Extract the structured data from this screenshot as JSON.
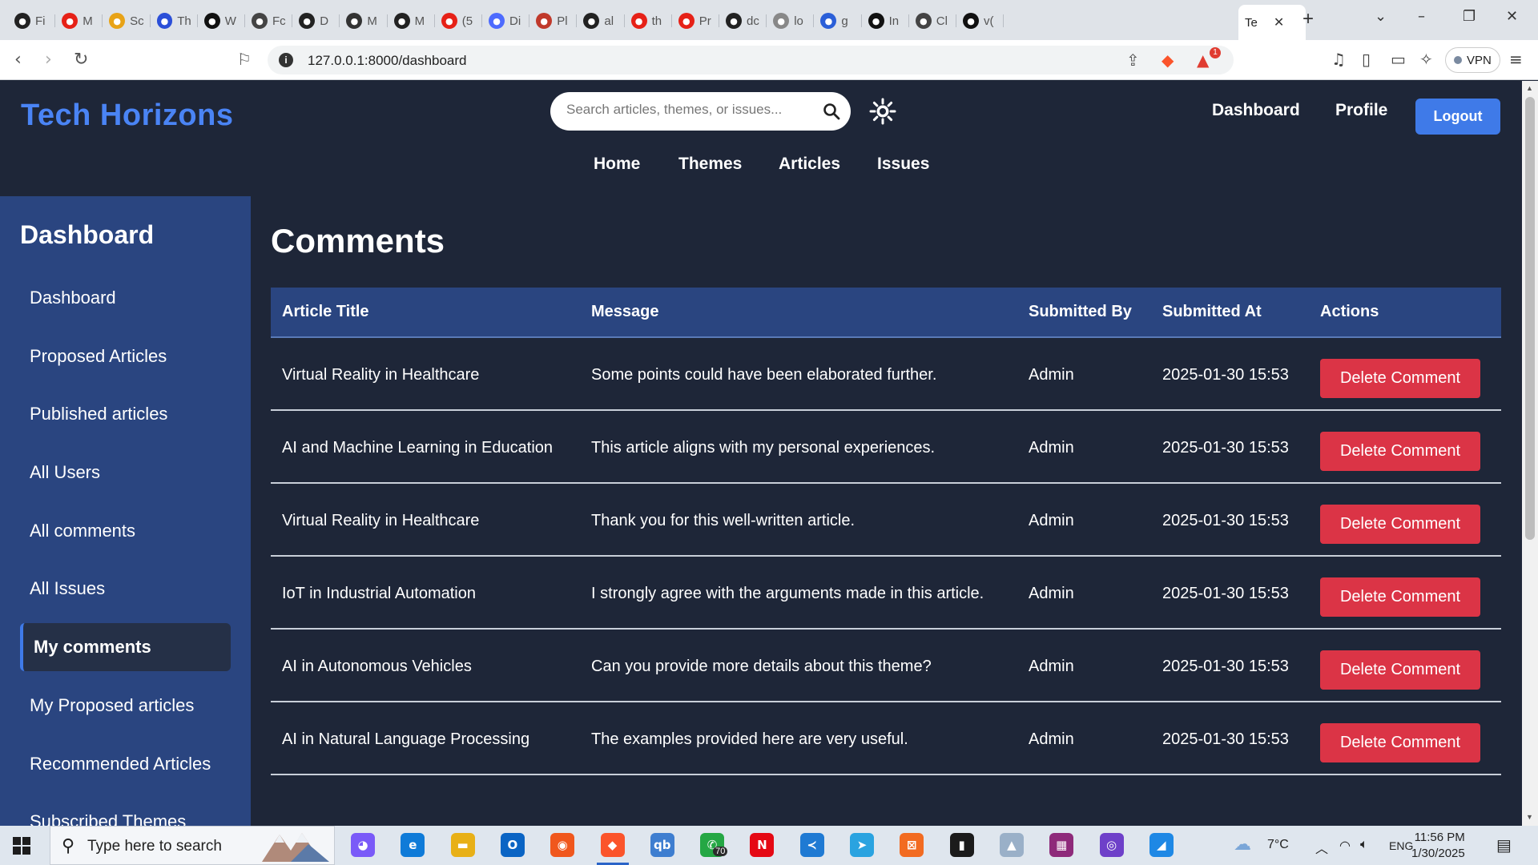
{
  "browser": {
    "tabs": [
      {
        "label": "Fi",
        "icon": "github-icon",
        "color": "#222222"
      },
      {
        "label": "M",
        "icon": "youtube-icon",
        "color": "#e62117"
      },
      {
        "label": "Sc",
        "icon": "scholar-icon",
        "color": "#e8a317"
      },
      {
        "label": "Th",
        "icon": "power-icon",
        "color": "#2b4fd8"
      },
      {
        "label": "W",
        "icon": "medium-icon",
        "color": "#111111"
      },
      {
        "label": "Fc",
        "icon": "openai-icon",
        "color": "#444444"
      },
      {
        "label": "D",
        "icon": "github-icon",
        "color": "#222222"
      },
      {
        "label": "M",
        "icon": "profile-icon",
        "color": "#333333"
      },
      {
        "label": "M",
        "icon": "github-icon",
        "color": "#222222"
      },
      {
        "label": "(5",
        "icon": "youtube-icon",
        "color": "#e62117"
      },
      {
        "label": "Di",
        "icon": "deepseek-icon",
        "color": "#4d6bfe"
      },
      {
        "label": "Pl",
        "icon": "plex-icon",
        "color": "#c0392b"
      },
      {
        "label": "al",
        "icon": "github-icon",
        "color": "#222222"
      },
      {
        "label": "th",
        "icon": "youtube-icon",
        "color": "#e62117"
      },
      {
        "label": "Pr",
        "icon": "youtube-icon",
        "color": "#e62117"
      },
      {
        "label": "dc",
        "icon": "github-icon",
        "color": "#222222"
      },
      {
        "label": "lo",
        "icon": "mountain-icon",
        "color": "#888888"
      },
      {
        "label": "g",
        "icon": "word-icon",
        "color": "#2b5fd8"
      },
      {
        "label": "In",
        "icon": "openai-icon",
        "color": "#111111"
      },
      {
        "label": "Cl",
        "icon": "openai-icon",
        "color": "#444444"
      },
      {
        "label": "v(",
        "icon": "vercel-icon",
        "color": "#111111"
      }
    ],
    "active_tab": {
      "label": "Te",
      "close": "✕"
    },
    "new_tab": "+",
    "url": "127.0.0.1:8000/dashboard",
    "brave_badge": "1",
    "vpn_label": "VPN"
  },
  "site": {
    "brand": "Tech Horizons",
    "search_placeholder": "Search articles, themes, or issues...",
    "top_links": {
      "dashboard": "Dashboard",
      "profile": "Profile",
      "logout": "Logout"
    },
    "main_nav": [
      "Home",
      "Themes",
      "Articles",
      "Issues"
    ]
  },
  "sidebar": {
    "title": "Dashboard",
    "items": [
      {
        "label": "Dashboard",
        "active": false
      },
      {
        "label": "Proposed Articles",
        "active": false
      },
      {
        "label": "Published articles",
        "active": false
      },
      {
        "label": "All Users",
        "active": false
      },
      {
        "label": "All comments",
        "active": false
      },
      {
        "label": "All Issues",
        "active": false
      },
      {
        "label": "My comments",
        "active": true
      },
      {
        "label": "My Proposed articles",
        "active": false
      },
      {
        "label": "Recommended Articles",
        "active": false
      },
      {
        "label": "Subscribed Themes",
        "active": false
      }
    ]
  },
  "comments": {
    "title": "Comments",
    "columns": [
      "Article Title",
      "Message",
      "Submitted By",
      "Submitted At",
      "Actions"
    ],
    "delete_label": "Delete Comment",
    "rows": [
      {
        "article": "Virtual Reality in Healthcare",
        "message": "Some points could have been elaborated further.",
        "by": "Admin",
        "at": "2025-01-30 15:53"
      },
      {
        "article": "AI and Machine Learning in Education",
        "message": "This article aligns with my personal experiences.",
        "by": "Admin",
        "at": "2025-01-30 15:53"
      },
      {
        "article": "Virtual Reality in Healthcare",
        "message": "Thank you for this well-written article.",
        "by": "Admin",
        "at": "2025-01-30 15:53"
      },
      {
        "article": "IoT in Industrial Automation",
        "message": "I strongly agree with the arguments made in this article.",
        "by": "Admin",
        "at": "2025-01-30 15:53"
      },
      {
        "article": "AI in Autonomous Vehicles",
        "message": "Can you provide more details about this theme?",
        "by": "Admin",
        "at": "2025-01-30 15:53"
      },
      {
        "article": "AI in Natural Language Processing",
        "message": "The examples provided here are very useful.",
        "by": "Admin",
        "at": "2025-01-30 15:53"
      }
    ]
  },
  "taskbar": {
    "search_placeholder": "Type here to search",
    "apps": [
      {
        "name": "copilot-icon",
        "glyph": "◕",
        "color": "#7a5af8"
      },
      {
        "name": "edge-icon",
        "glyph": "e",
        "color": "#0f7bd8"
      },
      {
        "name": "file-explorer-icon",
        "glyph": "▬",
        "color": "#e8b017"
      },
      {
        "name": "outlook-icon",
        "glyph": "O",
        "color": "#0a64c4"
      },
      {
        "name": "firefox-icon",
        "glyph": "◉",
        "color": "#f0571d"
      },
      {
        "name": "brave-icon",
        "glyph": "◆",
        "color": "#fb542b"
      },
      {
        "name": "qbittorrent-icon",
        "glyph": "qb",
        "color": "#3e7ed0"
      },
      {
        "name": "whatsapp-icon",
        "glyph": "✆",
        "color": "#25a744"
      },
      {
        "name": "netflix-icon",
        "glyph": "N",
        "color": "#e50914"
      },
      {
        "name": "vscode-icon",
        "glyph": "≺",
        "color": "#1f7ad3"
      },
      {
        "name": "telegram-icon",
        "glyph": "➤",
        "color": "#2aa3e0"
      },
      {
        "name": "xampp-icon",
        "glyph": "⊠",
        "color": "#f26b21"
      },
      {
        "name": "terminal-icon",
        "glyph": "▮",
        "color": "#1b1b1b"
      },
      {
        "name": "photos-icon",
        "glyph": "▲",
        "color": "#9ab0c8"
      },
      {
        "name": "winrar-icon",
        "glyph": "▦",
        "color": "#8e2a7a"
      },
      {
        "name": "github-desktop-icon",
        "glyph": "◎",
        "color": "#6e40c9"
      },
      {
        "name": "paint-icon",
        "glyph": "◢",
        "color": "#1e88e5"
      }
    ],
    "whatsapp_badge": "70",
    "weather": "7°C",
    "language": "ENG",
    "time": "11:56 PM",
    "date": "1/30/2025"
  }
}
